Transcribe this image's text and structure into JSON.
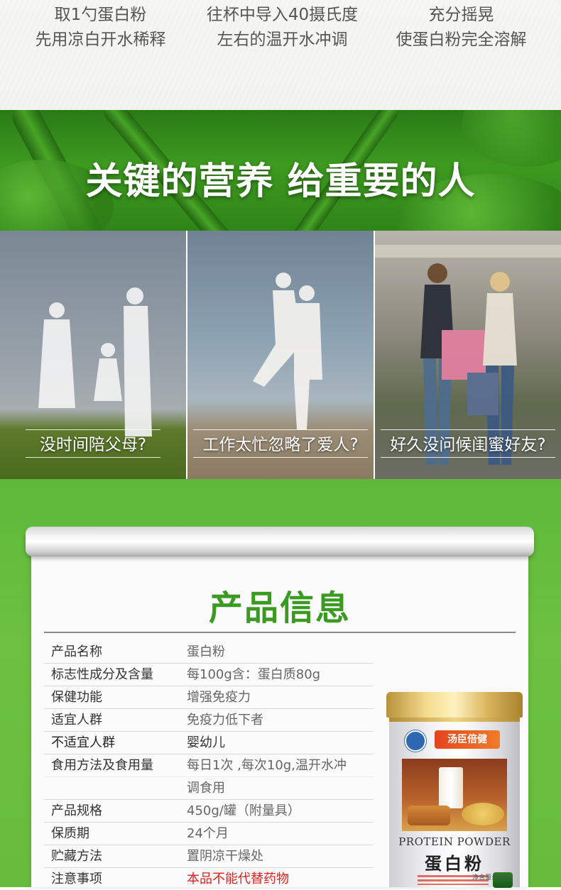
{
  "steps": [
    {
      "line1": "取1勺蛋白粉",
      "line2": "先用凉白开水稀释"
    },
    {
      "line1": "往杯中导入40摄氏度",
      "line2": "左右的温开水冲调"
    },
    {
      "line1": "充分摇晃",
      "line2": "使蛋白粉完全溶解"
    }
  ],
  "banner": {
    "title": "关键的营养 给重要的人"
  },
  "photos": [
    {
      "caption": "没时间陪父母?"
    },
    {
      "caption": "工作太忙忽略了爱人?"
    },
    {
      "caption": "好久没问候闺蜜好友?"
    }
  ],
  "product_info": {
    "title": "产品信息",
    "rows": [
      {
        "key": "产品名称",
        "value": "蛋白粉"
      },
      {
        "key": "标志性成分及含量",
        "value": "每100g含：蛋白质80g"
      },
      {
        "key": "保健功能",
        "value": "增强免疫力"
      },
      {
        "key": "适宜人群",
        "value": "免疫力低下者"
      },
      {
        "key": "不适宜人群",
        "value": "婴幼儿"
      },
      {
        "key": "食用方法及食用量",
        "value": " 每日1次 ,每次10g,温开水冲"
      },
      {
        "key": "",
        "value": "调食用"
      },
      {
        "key": "产品规格",
        "value": "450g/罐（附量具）"
      },
      {
        "key": "保质期",
        "value": "24个月"
      },
      {
        "key": "贮藏方法",
        "value": "置阴凉干燥处"
      },
      {
        "key": "注意事项",
        "value": "本品不能代替药物"
      }
    ]
  },
  "product_can": {
    "brand": "汤臣倍健",
    "name_en": "PROTEIN POWDER",
    "name_cn": "蛋白粉",
    "net_weight": "净含量:450g"
  },
  "colors": {
    "banner_green": "#3d9a1f",
    "info_green": "#67bc3c",
    "title_green": "#3a9a22",
    "warning_red": "#e0201c"
  }
}
